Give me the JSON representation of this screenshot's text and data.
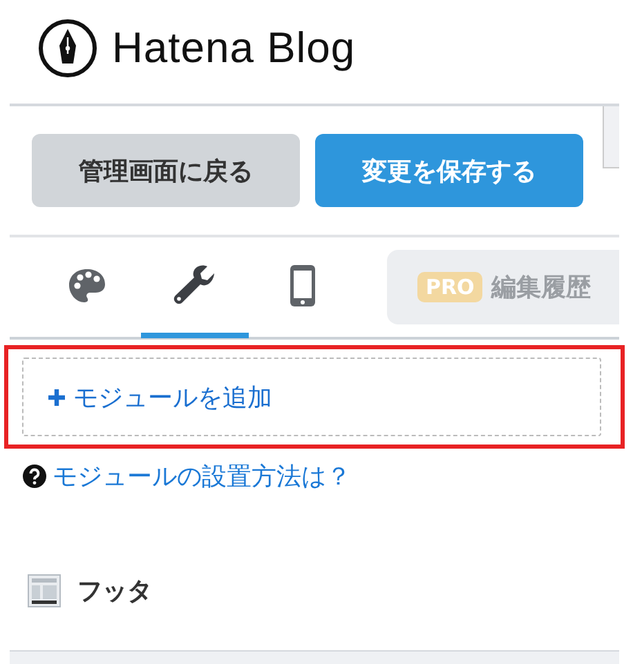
{
  "logo": {
    "text": "Hatena Blog"
  },
  "buttons": [
    {
      "label": "管理画面に戻る",
      "kind": "secondary"
    },
    {
      "label": "変更を保存する",
      "kind": "primary"
    }
  ],
  "tabs": [
    {
      "kind": "palette",
      "selected": false
    },
    {
      "kind": "wrench",
      "selected": true
    },
    {
      "kind": "phone",
      "selected": false
    }
  ],
  "history_button": {
    "badge": "PRO",
    "label": "編集履歴"
  },
  "add_module": {
    "label": "モジュールを追加",
    "highlighted": true
  },
  "help_link": {
    "text": "モジュールの設置方法は？"
  },
  "section": {
    "title": "フッタ"
  }
}
